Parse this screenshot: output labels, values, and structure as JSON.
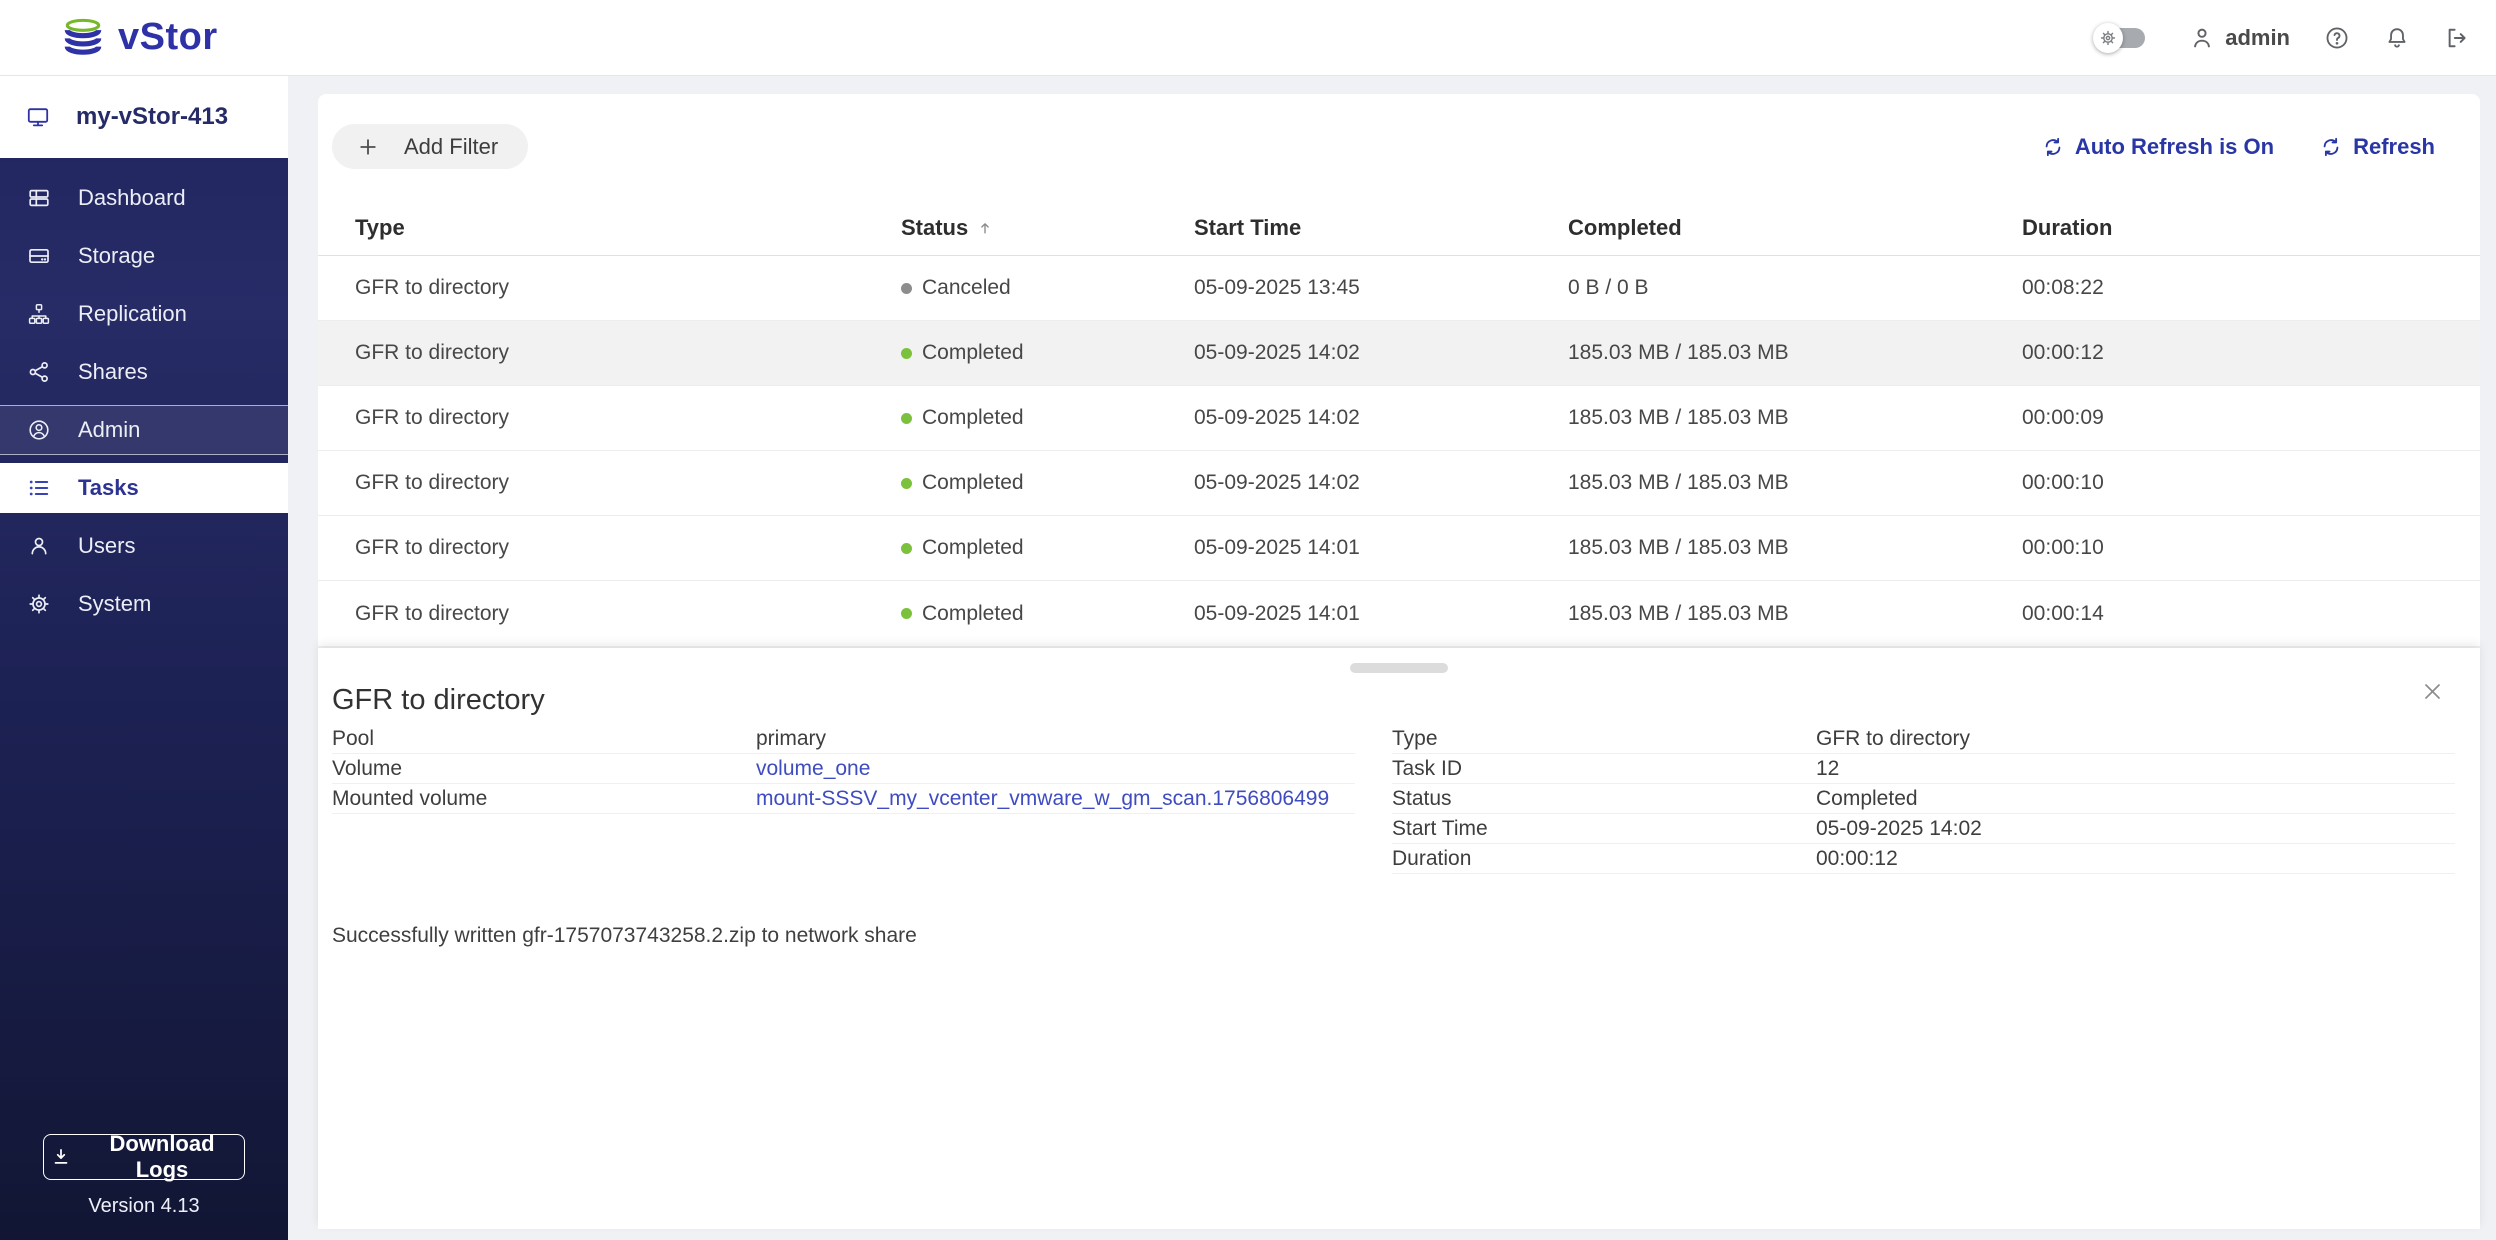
{
  "topbar": {
    "brand": "vStor",
    "theme_toggle_state": "off",
    "user_label": "admin"
  },
  "sidebar": {
    "node_name": "my-vStor-413",
    "items": [
      {
        "label": "Dashboard",
        "icon": "dashboard-icon",
        "active": false,
        "section": false
      },
      {
        "label": "Storage",
        "icon": "storage-icon",
        "active": false,
        "section": false
      },
      {
        "label": "Replication",
        "icon": "replication-icon",
        "active": false,
        "section": false
      },
      {
        "label": "Shares",
        "icon": "shares-icon",
        "active": false,
        "section": false
      },
      {
        "label": "Admin",
        "icon": "admin-icon",
        "active": false,
        "section": true
      },
      {
        "label": "Tasks",
        "icon": "tasks-icon",
        "active": true,
        "section": false
      },
      {
        "label": "Users",
        "icon": "users-icon",
        "active": false,
        "section": false
      },
      {
        "label": "System",
        "icon": "system-icon",
        "active": false,
        "section": false
      }
    ],
    "download_logs_label": "Download Logs",
    "version_label": "Version 4.13"
  },
  "toolbar": {
    "add_filter_label": "Add Filter",
    "auto_refresh_label": "Auto Refresh is On",
    "refresh_label": "Refresh"
  },
  "tasks_table": {
    "columns": [
      {
        "label": "Type",
        "sorted": false
      },
      {
        "label": "Status",
        "sorted": true
      },
      {
        "label": "Start Time",
        "sorted": false
      },
      {
        "label": "Completed",
        "sorted": false
      },
      {
        "label": "Duration",
        "sorted": false
      }
    ],
    "rows": [
      {
        "type": "GFR to directory",
        "status": "Canceled",
        "status_color": "#8d8d8d",
        "start_time": "05-09-2025 13:45",
        "completed": "0 B / 0 B",
        "duration": "00:08:22",
        "selected": false
      },
      {
        "type": "GFR to directory",
        "status": "Completed",
        "status_color": "#7cc13e",
        "start_time": "05-09-2025 14:02",
        "completed": "185.03 MB / 185.03 MB",
        "duration": "00:00:12",
        "selected": true
      },
      {
        "type": "GFR to directory",
        "status": "Completed",
        "status_color": "#7cc13e",
        "start_time": "05-09-2025 14:02",
        "completed": "185.03 MB / 185.03 MB",
        "duration": "00:00:09",
        "selected": false
      },
      {
        "type": "GFR to directory",
        "status": "Completed",
        "status_color": "#7cc13e",
        "start_time": "05-09-2025 14:02",
        "completed": "185.03 MB / 185.03 MB",
        "duration": "00:00:10",
        "selected": false
      },
      {
        "type": "GFR to directory",
        "status": "Completed",
        "status_color": "#7cc13e",
        "start_time": "05-09-2025 14:01",
        "completed": "185.03 MB / 185.03 MB",
        "duration": "00:00:10",
        "selected": false
      },
      {
        "type": "GFR to directory",
        "status": "Completed",
        "status_color": "#7cc13e",
        "start_time": "05-09-2025 14:01",
        "completed": "185.03 MB / 185.03 MB",
        "duration": "00:00:14",
        "selected": false
      }
    ]
  },
  "detail_panel": {
    "title": "GFR to directory",
    "fields_left": [
      {
        "label": "Pool",
        "value": "primary",
        "link": false
      },
      {
        "label": "Volume",
        "value": "volume_one",
        "link": true
      },
      {
        "label": "Mounted volume",
        "value": "mount-SSSV_my_vcenter_vmware_w_gm_scan.1756806499",
        "link": true
      }
    ],
    "fields_right": [
      {
        "label": "Type",
        "value": "GFR to directory"
      },
      {
        "label": "Task ID",
        "value": "12"
      },
      {
        "label": "Status",
        "value": "Completed"
      },
      {
        "label": "Start Time",
        "value": "05-09-2025 14:02"
      },
      {
        "label": "Duration",
        "value": "00:00:12"
      }
    ],
    "message": "Successfully written gfr-1757073743258.2.zip to network share"
  },
  "colors": {
    "brand_blue": "#2e32a6",
    "brand_green": "#76b82a",
    "accent_blue": "#2936a5",
    "link_blue": "#3f4cc0",
    "success_green": "#7cc13e",
    "canceled_gray": "#8d8d8d",
    "sidebar_navy_top": "#272b66",
    "sidebar_navy_bottom": "#121634"
  }
}
